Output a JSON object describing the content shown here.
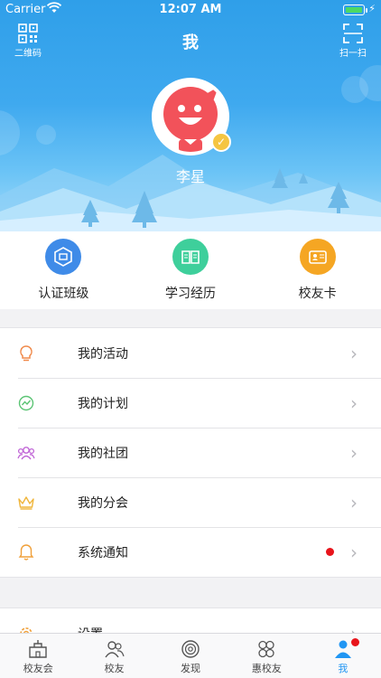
{
  "status_bar": {
    "carrier": "Carrier",
    "time": "12:07 AM"
  },
  "header": {
    "title": "我",
    "qr_label": "二维码",
    "scan_label": "扫一扫"
  },
  "profile": {
    "name": "李星"
  },
  "quick_actions": [
    {
      "label": "认证班级",
      "icon": "class-certify-icon",
      "color": "#3f8be8"
    },
    {
      "label": "学习经历",
      "icon": "book-icon",
      "color": "#3ecf9b"
    },
    {
      "label": "校友卡",
      "icon": "id-card-icon",
      "color": "#f5a623"
    }
  ],
  "menu": [
    {
      "label": "我的活动",
      "icon": "lightbulb-icon"
    },
    {
      "label": "我的计划",
      "icon": "trend-icon"
    },
    {
      "label": "我的社团",
      "icon": "group-icon"
    },
    {
      "label": "我的分会",
      "icon": "crown-icon"
    },
    {
      "label": "系统通知",
      "icon": "bell-icon",
      "has_dot": true
    }
  ],
  "menu2": [
    {
      "label": "设置",
      "icon": "settings-icon"
    }
  ],
  "tabs": [
    {
      "label": "校友会",
      "icon": "building-icon"
    },
    {
      "label": "校友",
      "icon": "people-icon"
    },
    {
      "label": "发现",
      "icon": "discover-icon"
    },
    {
      "label": "惠校友",
      "icon": "clover-icon"
    },
    {
      "label": "我",
      "icon": "person-icon",
      "active": true,
      "has_dot": true
    }
  ],
  "colors": {
    "accent": "#2196f3",
    "badge_red": "#e8141b",
    "avatar_red": "#f2525a"
  }
}
